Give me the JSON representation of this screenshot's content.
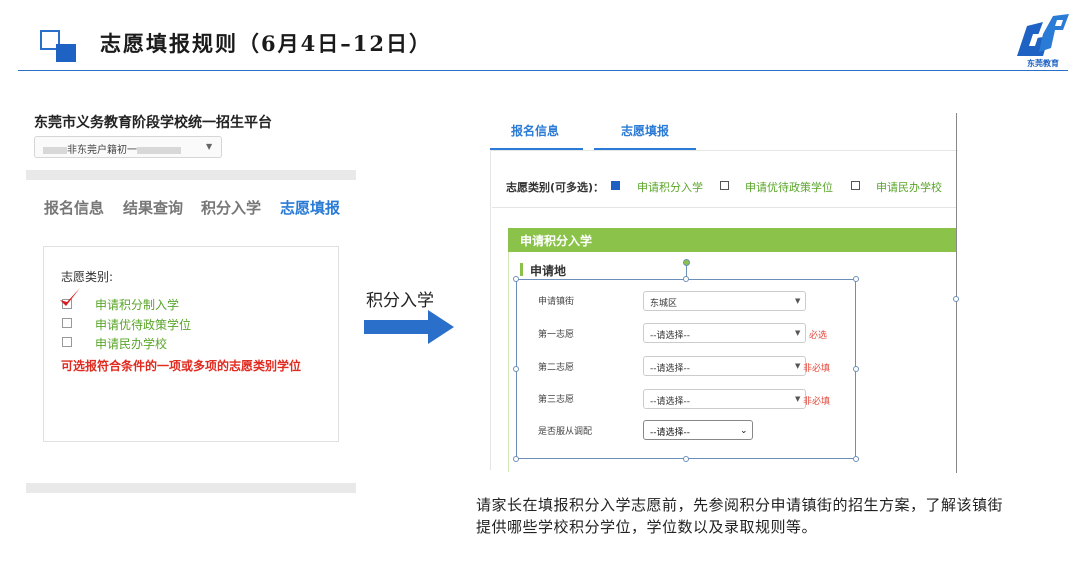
{
  "header": {
    "title": "志愿填报规则（6月4日–12日）",
    "logo_text": "东莞教育"
  },
  "left_panel": {
    "platform_title": "东莞市义务教育阶段学校统一招生平台",
    "account_select_text": "非东莞户籍初一",
    "tabs": [
      "报名信息",
      "结果查询",
      "积分入学",
      "志愿填报"
    ],
    "active_tab": "志愿填报",
    "category_label": "志愿类别:",
    "options": [
      {
        "label": "申请积分制入学",
        "checked": true
      },
      {
        "label": "申请优待政策学位",
        "checked": false
      },
      {
        "label": "申请民办学校",
        "checked": false
      }
    ],
    "note": "可选报符合条件的一项或多项的志愿类别学位",
    "colors": {
      "accent": "#2a7bd6",
      "option_green": "#5aa52a",
      "note_red": "#e02b20"
    }
  },
  "middle": {
    "arrow_label": "积分入学",
    "arrow_color": "#2a6fc9"
  },
  "right_panel": {
    "tabs": [
      "报名信息",
      "志愿填报"
    ],
    "type_label": "志愿类别(可多选)：",
    "type_options": [
      {
        "label": "申请积分入学",
        "checked": true
      },
      {
        "label": "申请优待政策学位",
        "checked": false
      },
      {
        "label": "申请民办学校",
        "checked": false
      }
    ],
    "section_title": "申请积分入学",
    "subsection_title": "申请地",
    "rows": [
      {
        "label": "申请镇街",
        "value": "东城区",
        "note": ""
      },
      {
        "label": "第一志愿",
        "value": "--请选择--",
        "note": "必选"
      },
      {
        "label": "第二志愿",
        "value": "--请选择--",
        "note": "非必填"
      },
      {
        "label": "第三志愿",
        "value": "--请选择--",
        "note": "非必填"
      }
    ],
    "adjust_label": "是否服从调配",
    "adjust_value": "--请选择--",
    "colors": {
      "section_green": "#8bc34a",
      "note_red": "#e0473b"
    }
  },
  "bottom_note": "请家长在填报积分入学志愿前，先参阅积分申请镇街的招生方案，了解该镇街提供哪些学校积分学位，学位数以及录取规则等。"
}
